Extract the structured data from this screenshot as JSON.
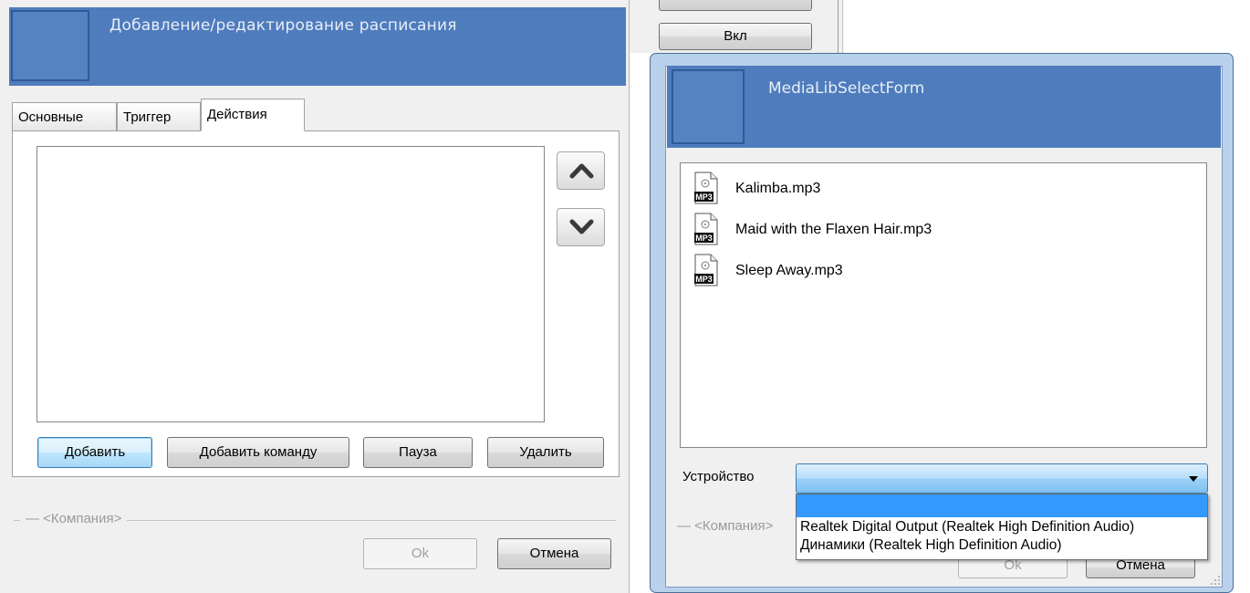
{
  "left_dialog": {
    "title": "Добавление/редактирование расписания",
    "tabs": [
      {
        "label": "Основные",
        "active": false
      },
      {
        "label": "Триггер",
        "active": false
      },
      {
        "label": "Действия",
        "active": true
      }
    ],
    "up_icon": "chevron-up-icon",
    "down_icon": "chevron-down-icon",
    "buttons": {
      "add": "Добавить",
      "add_command": "Добавить команду",
      "pause": "Пауза",
      "delete": "Удалить"
    },
    "company": "— <Компания>",
    "ok": "Ok",
    "cancel": "Отмена"
  },
  "background": {
    "on_button": "Вкл"
  },
  "right_dialog": {
    "title": "MediaLibSelectForm",
    "files": [
      {
        "name": "Kalimba.mp3",
        "icon": "mp3-file-icon"
      },
      {
        "name": "Maid with the Flaxen Hair.mp3",
        "icon": "mp3-file-icon"
      },
      {
        "name": "Sleep Away.mp3",
        "icon": "mp3-file-icon"
      }
    ],
    "device_label": "Устройство",
    "device_selected": "",
    "device_options": [
      "Realtek Digital Output (Realtek High Definition Audio)",
      "Динамики (Realtek High Definition Audio)"
    ],
    "company": "— <Компания>",
    "ok": "Ok",
    "cancel": "Отмена",
    "file_badge": "MP3"
  },
  "colors": {
    "header_blue": "#4f7cbc",
    "selection_blue": "#3399ff"
  }
}
